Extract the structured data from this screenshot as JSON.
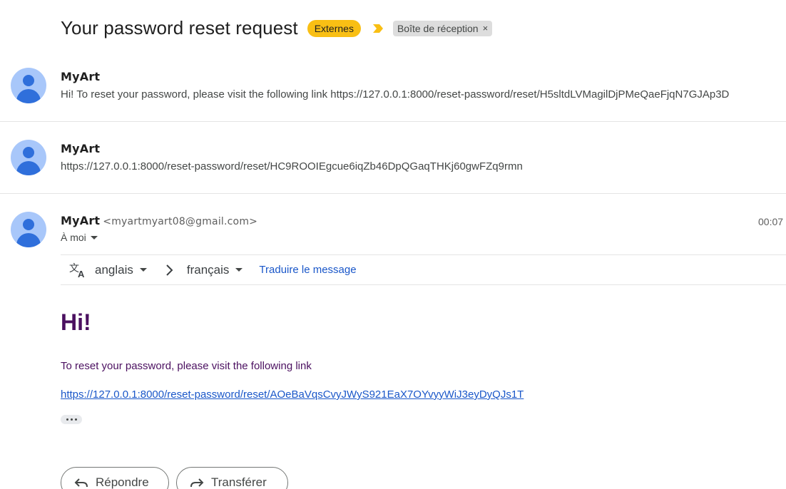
{
  "thread": {
    "subject": "Your password reset request",
    "labels": {
      "externes": "Externes",
      "inbox": "Boîte de réception",
      "inbox_close": "×"
    },
    "colors": {
      "externes_bg": "#f9bf14",
      "important_marker": "#f9bf14"
    }
  },
  "messages": [
    {
      "sender": "MyArt",
      "snippet": "Hi! To reset your password, please visit the following link https://127.0.0.1:8000/reset-password/reset/H5sltdLVMagilDjPMeQaeFjqN7GJAp3D"
    },
    {
      "sender": "MyArt",
      "snippet": "https://127.0.0.1:8000/reset-password/reset/HC9ROOIEgcue6iqZb46DpQGaqTHKj60gwFZq9rmn"
    }
  ],
  "open_message": {
    "sender": "MyArt",
    "sender_email": "<myartmyart08@gmail.com>",
    "to": "À moi",
    "time": "00:07",
    "translate": {
      "source_lang": "anglais",
      "target_lang": "français",
      "action": "Traduire le message"
    },
    "body": {
      "heading": "Hi!",
      "text": "To reset your password, please visit the following link",
      "link": "https://127.0.0.1:8000/reset-password/reset/AOeBaVqsCvyJWyS921EaX7OYvyyWiJ3eyDyQJs1T"
    },
    "actions": {
      "reply": "Répondre",
      "forward": "Transférer"
    }
  }
}
